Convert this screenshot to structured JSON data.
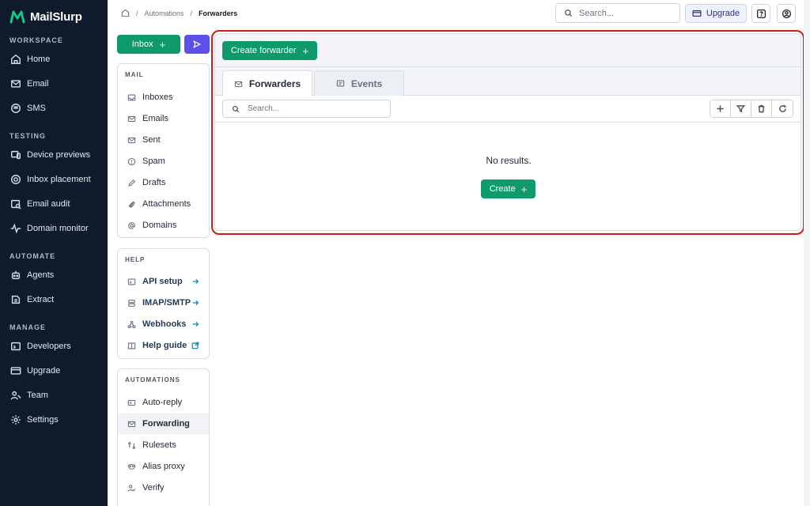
{
  "brand": {
    "name": "MailSlurp",
    "color": "#0e9a6a"
  },
  "sidebar": {
    "sections": [
      {
        "title": "WORKSPACE",
        "items": [
          {
            "label": "Home",
            "icon": "home-icon"
          },
          {
            "label": "Email",
            "icon": "mail-icon"
          },
          {
            "label": "SMS",
            "icon": "sms-icon"
          }
        ]
      },
      {
        "title": "TESTING",
        "items": [
          {
            "label": "Device previews",
            "icon": "device-icon"
          },
          {
            "label": "Inbox placement",
            "icon": "target-icon"
          },
          {
            "label": "Email audit",
            "icon": "audit-icon"
          },
          {
            "label": "Domain monitor",
            "icon": "pulse-icon"
          }
        ]
      },
      {
        "title": "AUTOMATE",
        "items": [
          {
            "label": "Agents",
            "icon": "robot-icon"
          },
          {
            "label": "Extract",
            "icon": "extract-icon"
          }
        ]
      },
      {
        "title": "MANAGE",
        "items": [
          {
            "label": "Developers",
            "icon": "terminal-icon"
          },
          {
            "label": "Upgrade",
            "icon": "card-icon"
          },
          {
            "label": "Team",
            "icon": "team-icon"
          },
          {
            "label": "Settings",
            "icon": "gear-icon"
          }
        ]
      }
    ]
  },
  "topbar": {
    "breadcrumb": [
      "Automations",
      "Forwarders"
    ],
    "search_placeholder": "Search...",
    "upgrade_label": "Upgrade"
  },
  "column": {
    "inbox_button": "Inbox",
    "mail": {
      "title": "MAIL",
      "items": [
        "Inboxes",
        "Emails",
        "Sent",
        "Spam",
        "Drafts",
        "Attachments",
        "Domains"
      ]
    },
    "help": {
      "title": "HELP",
      "items": [
        "API setup",
        "IMAP/SMTP",
        "Webhooks",
        "Help guide"
      ]
    },
    "automations": {
      "title": "AUTOMATIONS",
      "items": [
        "Auto-reply",
        "Forwarding",
        "Rulesets",
        "Alias proxy",
        "Verify"
      ],
      "active": "Forwarding"
    }
  },
  "main": {
    "create_forwarder_label": "Create forwarder",
    "tabs": [
      {
        "label": "Forwarders",
        "active": true
      },
      {
        "label": "Events",
        "active": false
      }
    ],
    "search_placeholder": "Search...",
    "empty_text": "No results.",
    "create_label": "Create"
  }
}
